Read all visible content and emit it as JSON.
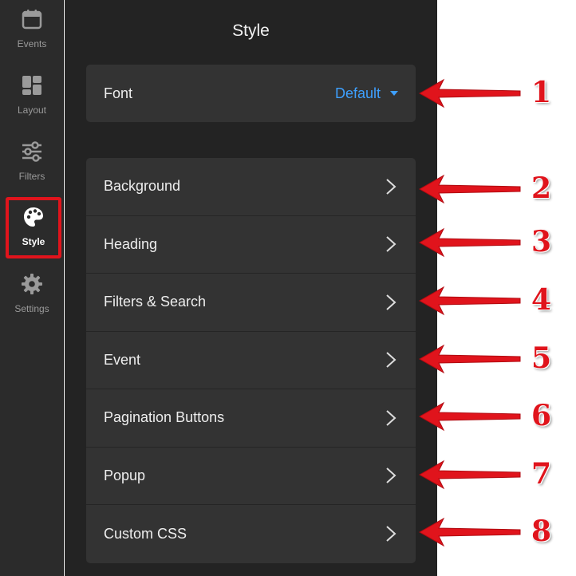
{
  "rail": {
    "items": [
      {
        "label": "Events",
        "icon": "calendar-icon"
      },
      {
        "label": "Layout",
        "icon": "layout-icon"
      },
      {
        "label": "Filters",
        "icon": "sliders-icon"
      },
      {
        "label": "Style",
        "icon": "palette-icon",
        "active": true
      },
      {
        "label": "Settings",
        "icon": "gear-icon"
      }
    ]
  },
  "panel": {
    "title": "Style",
    "font": {
      "label": "Font",
      "value": "Default"
    },
    "rows": [
      {
        "label": "Background"
      },
      {
        "label": "Heading"
      },
      {
        "label": "Filters & Search"
      },
      {
        "label": "Event"
      },
      {
        "label": "Pagination Buttons"
      },
      {
        "label": "Popup"
      },
      {
        "label": "Custom CSS"
      }
    ]
  },
  "annotations": [
    "1",
    "2",
    "3",
    "4",
    "5",
    "6",
    "7",
    "8"
  ],
  "colors": {
    "accent": "#3ea0ff",
    "annotation_red": "#e0141c",
    "panel_bg": "#232323",
    "card_bg": "#333333",
    "rail_bg": "#2b2b2b"
  }
}
